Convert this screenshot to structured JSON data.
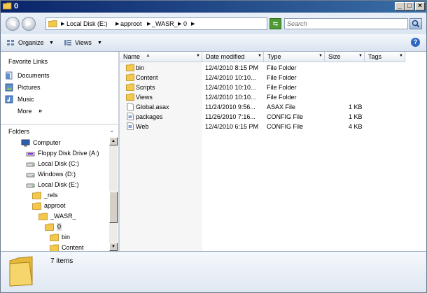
{
  "window": {
    "title": "0"
  },
  "address": {
    "crumbs": [
      "Local Disk (E:)",
      "approot",
      "_WASR_",
      "0"
    ]
  },
  "search": {
    "placeholder": "Search"
  },
  "toolbar": {
    "organize_label": "Organize",
    "views_label": "Views"
  },
  "nav": {
    "favorites_title": "Favorite Links",
    "favorites": [
      {
        "label": "Documents",
        "icon": "documents-icon"
      },
      {
        "label": "Pictures",
        "icon": "pictures-icon"
      },
      {
        "label": "Music",
        "icon": "music-icon"
      },
      {
        "label": "More",
        "icon": "chevron-right-icon"
      }
    ],
    "folders_title": "Folders",
    "tree": [
      {
        "label": "Computer",
        "icon": "computer-icon"
      },
      {
        "label": "Floppy Disk Drive (A:)",
        "icon": "floppy-icon"
      },
      {
        "label": "Local Disk (C:)",
        "icon": "drive-icon"
      },
      {
        "label": "Windows (D:)",
        "icon": "drive-icon"
      },
      {
        "label": "Local Disk (E:)",
        "icon": "drive-icon"
      },
      {
        "label": "_rels",
        "icon": "folder-icon"
      },
      {
        "label": "approot",
        "icon": "folder-icon"
      },
      {
        "label": "_WASR_",
        "icon": "folder-icon"
      },
      {
        "label": "0",
        "icon": "folder-icon"
      },
      {
        "label": "bin",
        "icon": "folder-icon"
      },
      {
        "label": "Content",
        "icon": "folder-icon"
      }
    ]
  },
  "columns": [
    "Name",
    "Date modified",
    "Type",
    "Size",
    "Tags"
  ],
  "files": [
    {
      "name": "bin",
      "date": "12/4/2010 8:15 PM",
      "type": "File Folder",
      "size": "",
      "icon": "folder"
    },
    {
      "name": "Content",
      "date": "12/4/2010 10:10...",
      "type": "File Folder",
      "size": "",
      "icon": "folder"
    },
    {
      "name": "Scripts",
      "date": "12/4/2010 10:10...",
      "type": "File Folder",
      "size": "",
      "icon": "folder"
    },
    {
      "name": "Views",
      "date": "12/4/2010 10:10...",
      "type": "File Folder",
      "size": "",
      "icon": "folder"
    },
    {
      "name": "Global.asax",
      "date": "11/24/2010 9:56...",
      "type": "ASAX File",
      "size": "1 KB",
      "icon": "file"
    },
    {
      "name": "packages",
      "date": "11/26/2010 7:16...",
      "type": "CONFIG File",
      "size": "1 KB",
      "icon": "config"
    },
    {
      "name": "Web",
      "date": "12/4/2010 6:15 PM",
      "type": "CONFIG File",
      "size": "4 KB",
      "icon": "config"
    }
  ],
  "status": {
    "item_count": "7 items"
  },
  "colors": {
    "title_bar": "#0a246a",
    "folder": "#f2c94c",
    "selection": "#d9d9d9"
  }
}
